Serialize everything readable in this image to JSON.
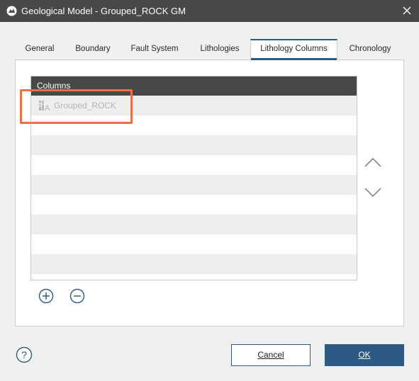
{
  "window": {
    "title": "Geological Model - Grouped_ROCK GM",
    "close_icon": "close-icon"
  },
  "tabs": [
    {
      "label": "General",
      "active": false
    },
    {
      "label": "Boundary",
      "active": false
    },
    {
      "label": "Fault System",
      "active": false
    },
    {
      "label": "Lithologies",
      "active": false
    },
    {
      "label": "Lithology Columns",
      "active": true
    },
    {
      "label": "Chronology",
      "active": false
    }
  ],
  "columns_table": {
    "header": "Columns",
    "rows": [
      {
        "label": "Grouped_ROCK",
        "icon": "lithology-column-icon"
      }
    ]
  },
  "controls": {
    "move_up_icon": "chevron-up-icon",
    "move_down_icon": "chevron-down-icon",
    "add_icon": "plus-circle-icon",
    "remove_icon": "minus-circle-icon",
    "help_icon": "question-circle-icon"
  },
  "buttons": {
    "cancel": "Cancel",
    "ok": "OK"
  },
  "colors": {
    "titlebar": "#484848",
    "accent": "#2c5a84",
    "highlight": "#ea6f4a"
  }
}
